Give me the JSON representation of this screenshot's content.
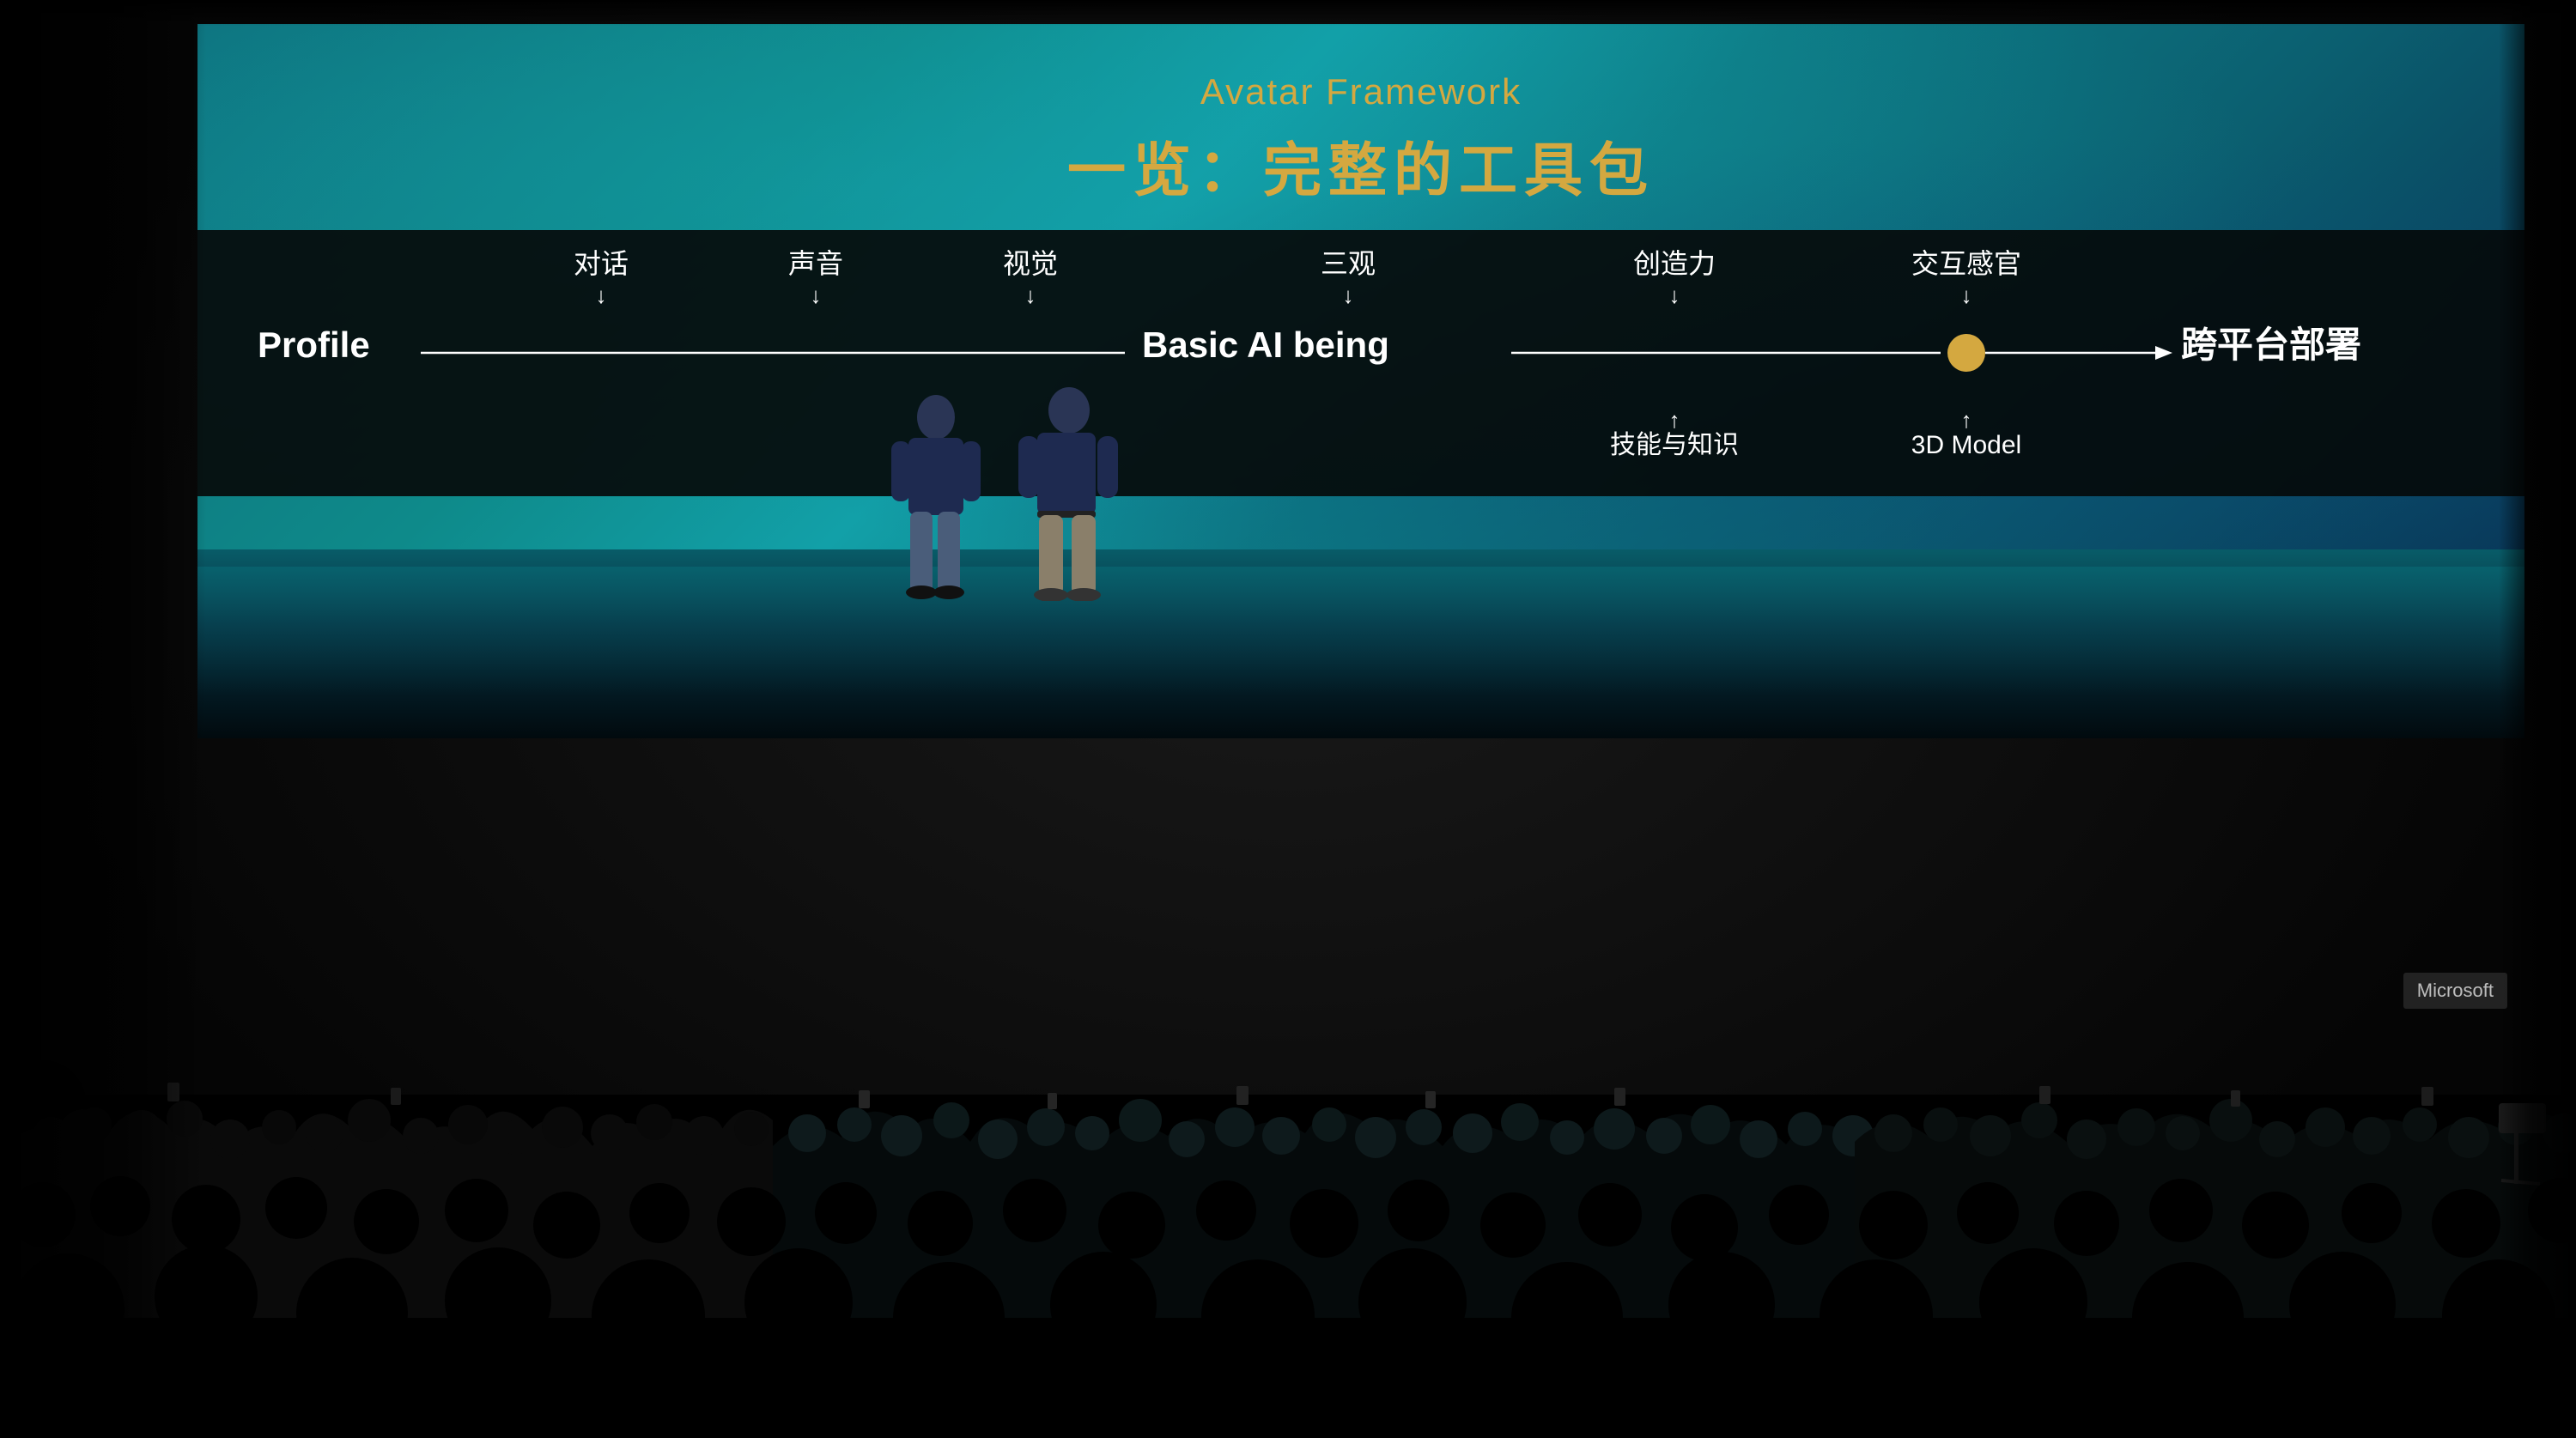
{
  "presentation": {
    "title_en": "Avatar Framework",
    "title_cn": "一览：完整的工具包",
    "diagram": {
      "nodes": {
        "start": "Profile",
        "middle": "Basic AI being",
        "end": "跨平台部署"
      },
      "labels_above": [
        {
          "text": "对话",
          "x_pct": 0.19
        },
        {
          "text": "声音",
          "x_pct": 0.28
        },
        {
          "text": "视觉",
          "x_pct": 0.37
        },
        {
          "text": "三观",
          "x_pct": 0.5
        },
        {
          "text": "创造力",
          "x_pct": 0.65
        },
        {
          "text": "交互感官",
          "x_pct": 0.78
        }
      ],
      "labels_below": [
        {
          "text": "技能与知识",
          "x_pct": 0.65
        },
        {
          "text": "3D Model",
          "x_pct": 0.76
        }
      ]
    }
  },
  "watermark": {
    "text": "Microsoft"
  }
}
